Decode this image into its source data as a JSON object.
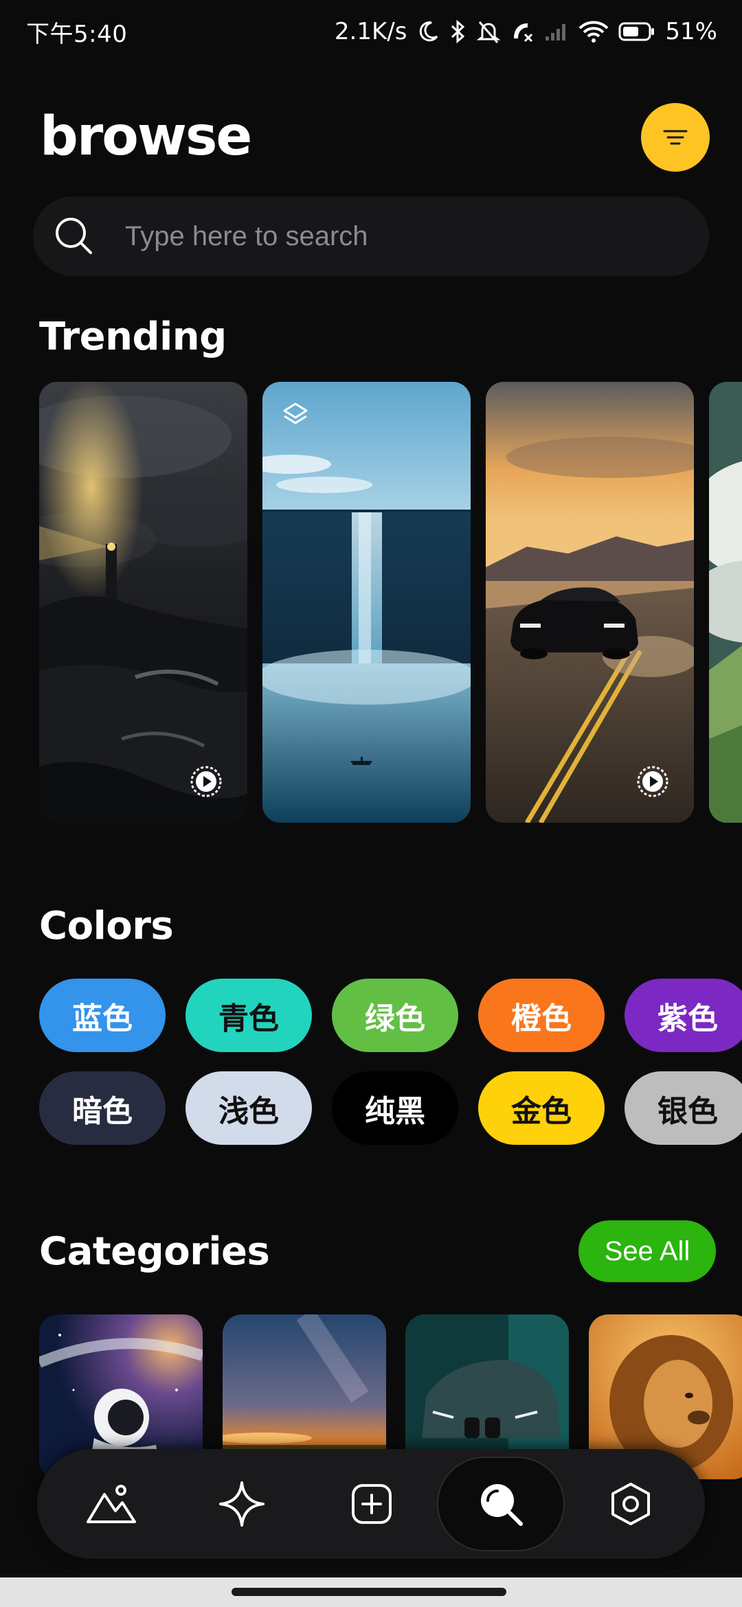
{
  "status_bar": {
    "time": "下午5:40",
    "net_speed": "2.1K/s",
    "battery": "51%",
    "icons": [
      "moon-icon",
      "bluetooth-icon",
      "bell-off-icon",
      "call-icon",
      "signal-icon",
      "wifi-icon",
      "battery-icon"
    ]
  },
  "header": {
    "title": "browse",
    "filter_icon": "filter-lines-icon",
    "accent": "#fdc424"
  },
  "search": {
    "placeholder": "Type here to search",
    "icon": "search-icon"
  },
  "trending": {
    "title": "Trending",
    "cards": [
      {
        "name": "lighthouse-storm",
        "badge": "live-play-icon"
      },
      {
        "name": "waterfall-ocean",
        "badge": "layers-icon"
      },
      {
        "name": "muscle-car-desert",
        "badge": "live-play-icon"
      },
      {
        "name": "mountain-clouds",
        "badge": ""
      }
    ]
  },
  "colors": {
    "title": "Colors",
    "chips": [
      {
        "label": "蓝色",
        "bg": "#3493ea",
        "fg": "#ffffff"
      },
      {
        "label": "青色",
        "bg": "#22d4bd",
        "fg": "#111111"
      },
      {
        "label": "绿色",
        "bg": "#62bf44",
        "fg": "#ffffff"
      },
      {
        "label": "橙色",
        "bg": "#f9761c",
        "fg": "#ffffff"
      },
      {
        "label": "紫色",
        "bg": "#7c29c3",
        "fg": "#ffffff"
      },
      {
        "label": "暗色",
        "bg": "#272c40",
        "fg": "#ffffff"
      },
      {
        "label": "浅色",
        "bg": "#d2dbea",
        "fg": "#111111"
      },
      {
        "label": "纯黑",
        "bg": "#000000",
        "fg": "#ffffff"
      },
      {
        "label": "金色",
        "bg": "#ffd10a",
        "fg": "#111111"
      },
      {
        "label": "银色",
        "bg": "#bdbdbd",
        "fg": "#111111"
      }
    ]
  },
  "categories": {
    "title": "Categories",
    "see_all": "See All",
    "see_all_color": "#2cb40f",
    "cards": [
      {
        "name": "space-astronaut"
      },
      {
        "name": "sunset-sky"
      },
      {
        "name": "cars"
      },
      {
        "name": "lion-animals"
      }
    ]
  },
  "bottom_nav": {
    "items": [
      {
        "name": "wallpapers-icon"
      },
      {
        "name": "ai-sparkle-icon"
      },
      {
        "name": "add-icon"
      },
      {
        "name": "browse-search-icon",
        "active": true
      },
      {
        "name": "settings-icon"
      }
    ]
  }
}
